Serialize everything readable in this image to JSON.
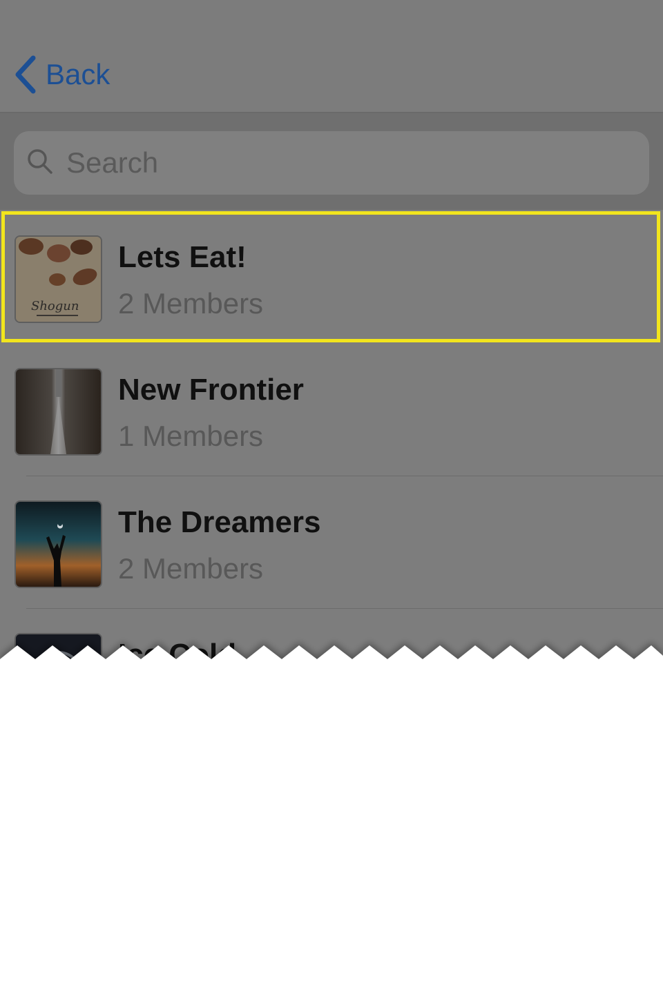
{
  "nav": {
    "back_label": "Back"
  },
  "search": {
    "placeholder": "Search"
  },
  "groups": [
    {
      "title": "Lets Eat!",
      "members": "2 Members",
      "thumb_text": "Shogun"
    },
    {
      "title": "New Frontier",
      "members": "1 Members"
    },
    {
      "title": "The Dreamers",
      "members": "2 Members"
    },
    {
      "title": "Ice Cold"
    }
  ],
  "colors": {
    "accent": "#1c4f94",
    "highlight": "#f2e51d"
  }
}
